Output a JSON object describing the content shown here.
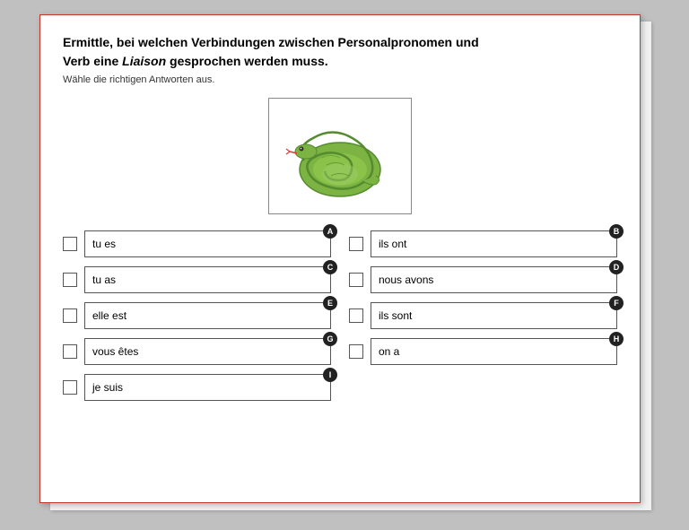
{
  "title_part1": "Ermittle, bei welchen Verbindungen zwischen Personalpronomen und",
  "title_part2": "Verb eine ",
  "title_liaison": "Liaison",
  "title_part3": " gesprochen werden muss.",
  "subtitle": "Wähle die richtigen Antworten aus.",
  "options": [
    {
      "id": "A",
      "text": "tu es",
      "col": 0
    },
    {
      "id": "B",
      "text": "ils ont",
      "col": 1
    },
    {
      "id": "C",
      "text": "tu as",
      "col": 0
    },
    {
      "id": "D",
      "text": "nous avons",
      "col": 1
    },
    {
      "id": "E",
      "text": "elle est",
      "col": 0
    },
    {
      "id": "F",
      "text": "ils sont",
      "col": 1
    },
    {
      "id": "G",
      "text": "vous êtes",
      "col": 0
    },
    {
      "id": "H",
      "text": "on a",
      "col": 1
    },
    {
      "id": "I",
      "text": "je suis",
      "col": 0
    }
  ]
}
